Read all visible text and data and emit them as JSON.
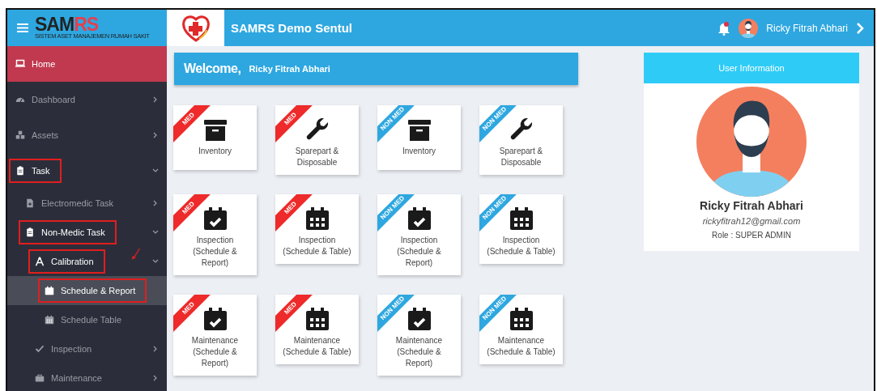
{
  "header": {
    "brand": "SAMRS",
    "brand_tagline": "SISTEM ASET MANAJEMEN RUMAH SAKIT",
    "title": "SAMRS Demo Sentul",
    "user_name": "Ricky Fitrah Abhari",
    "notification_dot": true
  },
  "sidebar": {
    "items": [
      {
        "label": "Home",
        "selected": true,
        "annotated": false
      },
      {
        "label": "Dashboard",
        "selected": false,
        "annotated": false,
        "expanded": false
      },
      {
        "label": "Assets",
        "selected": false,
        "annotated": false,
        "expanded": false
      },
      {
        "label": "Task",
        "selected": false,
        "annotated": true,
        "expanded": true,
        "children": [
          {
            "label": "Electromedic Task",
            "selected": false,
            "annotated": false,
            "expanded": false
          },
          {
            "label": "Non-Medic Task",
            "selected": false,
            "annotated": true,
            "expanded": true,
            "children": [
              {
                "label": "Calibration",
                "selected": false,
                "annotated": true,
                "expanded": true,
                "arrow": true,
                "children": [
                  {
                    "label": "Schedule & Report",
                    "selected": true,
                    "annotated": true
                  },
                  {
                    "label": "Schedule Table",
                    "selected": false,
                    "annotated": false
                  }
                ]
              },
              {
                "label": "Inspection",
                "selected": false,
                "annotated": false,
                "expanded": false
              },
              {
                "label": "Maintenance",
                "selected": false,
                "annotated": false,
                "expanded": false
              }
            ]
          }
        ]
      }
    ]
  },
  "welcome": {
    "greeting": "Welcome,",
    "name": "Ricky Fitrah Abhari"
  },
  "cards": [
    {
      "ribbon": "MED",
      "color": "#ee2a2a",
      "kind": "inventory",
      "label": "Inventory"
    },
    {
      "ribbon": "MED",
      "color": "#ee2a2a",
      "kind": "sparepart",
      "label": "Sparepart & Disposable"
    },
    {
      "ribbon": "NON MED",
      "color": "#2ea7e0",
      "kind": "inventory",
      "label": "Inventory"
    },
    {
      "ribbon": "NON MED",
      "color": "#2ea7e0",
      "kind": "sparepart",
      "label": "Sparepart & Disposable"
    },
    {
      "ribbon": "MED",
      "color": "#ee2a2a",
      "kind": "report",
      "label": "Inspection (Schedule & Report)"
    },
    {
      "ribbon": "MED",
      "color": "#ee2a2a",
      "kind": "table",
      "label": "Inspection (Schedule & Table)"
    },
    {
      "ribbon": "NON MED",
      "color": "#2ea7e0",
      "kind": "report",
      "label": "Inspection (Schedule & Report)"
    },
    {
      "ribbon": "NON MED",
      "color": "#2ea7e0",
      "kind": "table",
      "label": "Inspection (Schedule & Table)"
    },
    {
      "ribbon": "MED",
      "color": "#ee2a2a",
      "kind": "report",
      "label": "Maintenance (Schedule & Report)"
    },
    {
      "ribbon": "MED",
      "color": "#ee2a2a",
      "kind": "table",
      "label": "Maintenance (Schedule & Table)"
    },
    {
      "ribbon": "NON MED",
      "color": "#2ea7e0",
      "kind": "report",
      "label": "Maintenance (Schedule & Report)"
    },
    {
      "ribbon": "NON MED",
      "color": "#2ea7e0",
      "kind": "table",
      "label": "Maintenance (Schedule & Table)"
    }
  ],
  "user_info": {
    "title": "User Information",
    "name": "Ricky Fitrah Abhari",
    "email": "rickyfitrah12@gmail.com",
    "role": "Role : SUPER ADMIN"
  }
}
